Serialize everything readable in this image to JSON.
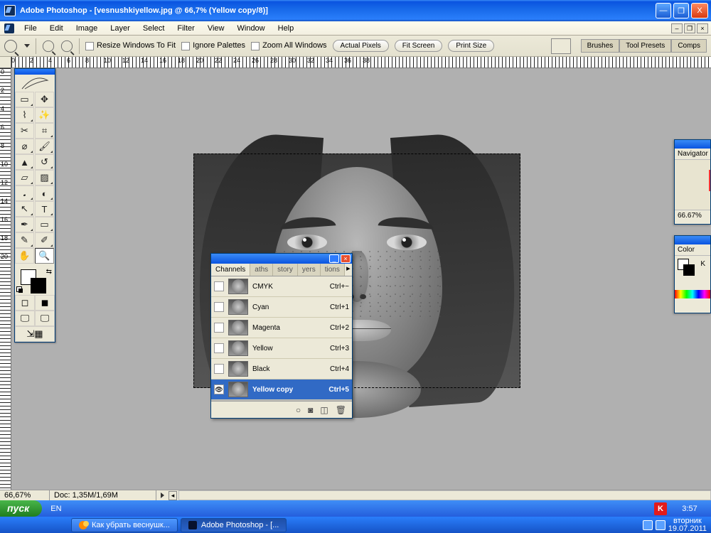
{
  "window": {
    "title": "Adobe Photoshop - [vesnushkiyellow.jpg @ 66,7% (Yellow copy/8)]",
    "min_glyph": "—",
    "max_glyph": "❐",
    "close_glyph": "X"
  },
  "menu": [
    "File",
    "Edit",
    "Image",
    "Layer",
    "Select",
    "Filter",
    "View",
    "Window",
    "Help"
  ],
  "mdi": {
    "min": "–",
    "restore": "❐",
    "close": "×"
  },
  "options_bar": {
    "resize_windows": "Resize Windows To Fit",
    "ignore_palettes": "Ignore Palettes",
    "zoom_all": "Zoom All Windows",
    "actual_pixels": "Actual Pixels",
    "fit_screen": "Fit Screen",
    "print_size": "Print Size"
  },
  "dock_tabs": [
    "Brushes",
    "Tool Presets",
    "Comps"
  ],
  "ruler_top": [
    "0",
    "2",
    "4",
    "6",
    "8",
    "10",
    "12",
    "14",
    "16",
    "18",
    "20",
    "22",
    "24",
    "26",
    "28",
    "30",
    "32",
    "34",
    "36",
    "38"
  ],
  "ruler_left": [
    "0",
    "2",
    "4",
    "6",
    "8",
    "10",
    "12",
    "14",
    "16",
    "18",
    "20"
  ],
  "channels_panel": {
    "tabs": [
      "Channels",
      "aths",
      "story",
      "yers",
      "tions"
    ],
    "rows": [
      {
        "name": "CMYK",
        "key": "Ctrl+~",
        "visible": false,
        "selected": false
      },
      {
        "name": "Cyan",
        "key": "Ctrl+1",
        "visible": false,
        "selected": false
      },
      {
        "name": "Magenta",
        "key": "Ctrl+2",
        "visible": false,
        "selected": false
      },
      {
        "name": "Yellow",
        "key": "Ctrl+3",
        "visible": false,
        "selected": false
      },
      {
        "name": "Black",
        "key": "Ctrl+4",
        "visible": false,
        "selected": false
      },
      {
        "name": "Yellow copy",
        "key": "Ctrl+5",
        "visible": true,
        "selected": true
      }
    ],
    "footer_icons": [
      "○",
      "◙",
      "◫",
      "🗑"
    ]
  },
  "navigator": {
    "title": "Navigator",
    "zoom": "66.67%"
  },
  "color": {
    "title": "Color",
    "component": "K"
  },
  "status": {
    "zoom": "66,67%",
    "doc": "Doc: 1,35M/1,69M"
  },
  "taskbar": {
    "start": "пуск",
    "lang": "EN",
    "tasks": [
      {
        "label": "Как убрать веснушк...",
        "active": false,
        "icon": "firefox"
      },
      {
        "label": "Adobe Photoshop - [...",
        "active": true,
        "icon": "ps"
      }
    ],
    "kav": "K",
    "time": "3:57",
    "day": "вторник",
    "date": "19.07.2011"
  }
}
